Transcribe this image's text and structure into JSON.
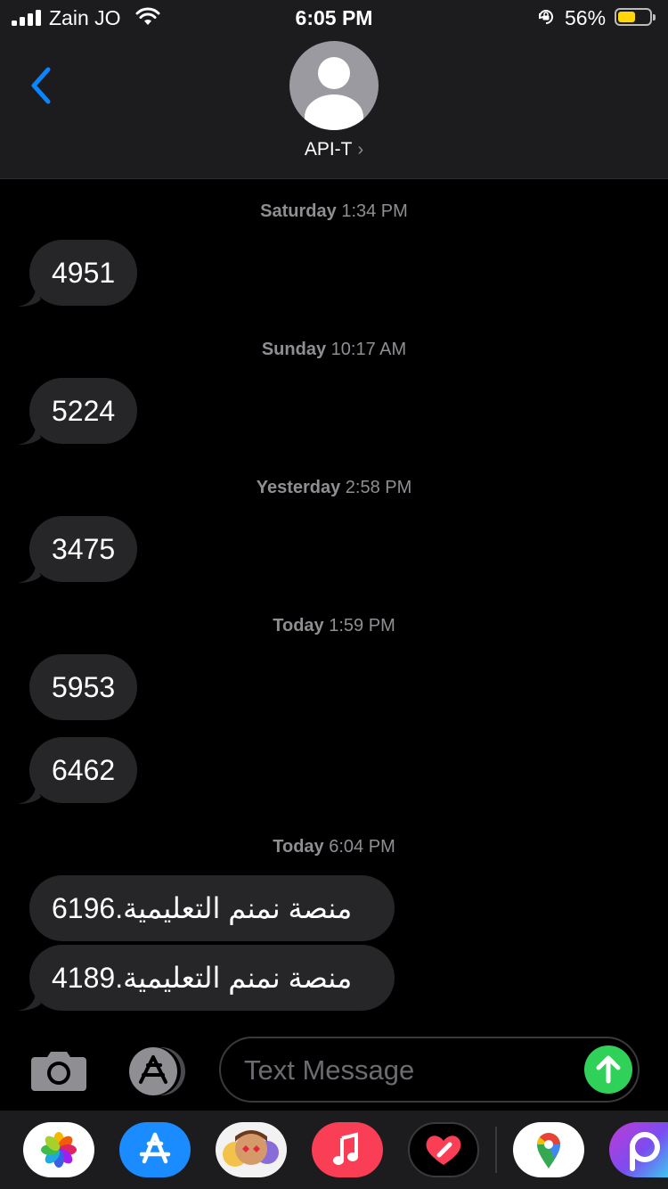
{
  "status_bar": {
    "carrier": "Zain JO",
    "time": "6:05 PM",
    "battery_percent": "56%",
    "battery_level": 0.56,
    "battery_color": "#ffd60a",
    "icons": [
      "signal-icon",
      "wifi-icon",
      "orientation-lock-icon",
      "battery-icon"
    ]
  },
  "header": {
    "contact_name": "API-T",
    "chevron": "›",
    "back_icon": "chevron-left-icon",
    "accent_color": "#0a84ff"
  },
  "messages": [
    {
      "timestamp_day": "Saturday",
      "timestamp_time": "1:34 PM",
      "texts": [
        "4951"
      ]
    },
    {
      "timestamp_day": "Sunday",
      "timestamp_time": "10:17 AM",
      "texts": [
        "5224"
      ]
    },
    {
      "timestamp_day": "Yesterday",
      "timestamp_time": "2:58 PM",
      "texts": [
        "3475"
      ]
    },
    {
      "timestamp_day": "Today",
      "timestamp_time": "1:59 PM",
      "texts": [
        "5953",
        "6462"
      ]
    },
    {
      "timestamp_day": "Today",
      "timestamp_time": "6:04 PM",
      "texts": [
        "منصة نمنم التعليمية.6196",
        "منصة نمنم التعليمية.4189"
      ]
    }
  ],
  "compose": {
    "placeholder": "Text Message",
    "send_color": "#30d158"
  },
  "app_drawer": {
    "apps": [
      "photos-icon",
      "app-store-icon",
      "memoji-icon",
      "music-icon",
      "digital-touch-icon",
      "google-maps-icon",
      "picsart-icon"
    ]
  }
}
